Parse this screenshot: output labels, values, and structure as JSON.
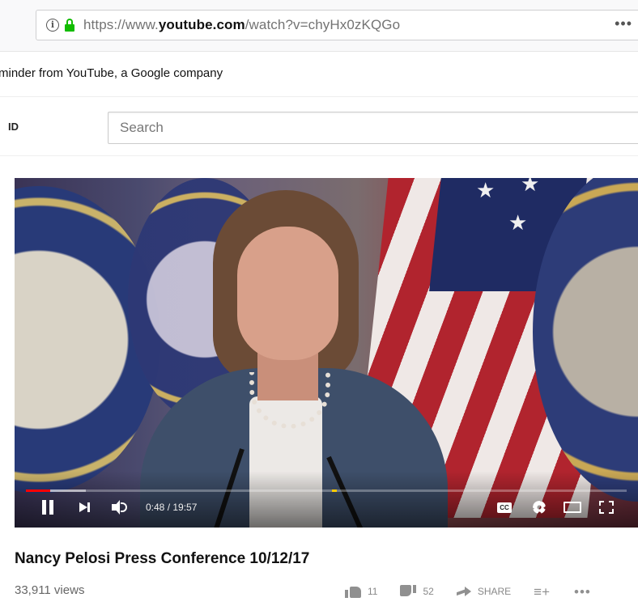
{
  "browser": {
    "url_prefix": "https://www.",
    "url_domain": "youtube.com",
    "url_path": "/watch?v=chyHx0zKQGo",
    "overflow": "•••"
  },
  "reminder": {
    "text": "minder from YouTube, a Google company"
  },
  "masthead": {
    "logo_fragment": "ID",
    "search_placeholder": "Search"
  },
  "player": {
    "time": "0:48 / 19:57",
    "progress_played_fraction": 0.04,
    "progress_loaded_fraction": 0.1,
    "cc_label": "CC"
  },
  "video": {
    "title": "Nancy Pelosi Press Conference 10/12/17",
    "views": "33,911 views",
    "likes": "11",
    "dislikes": "52",
    "share_label": "SHARE",
    "add_to_glyph": "≡+",
    "more_glyph": "•••"
  },
  "colors": {
    "progress_played": "#ff0000",
    "ad_marker": "#ffcc00",
    "secure_lock": "#12bc00"
  }
}
